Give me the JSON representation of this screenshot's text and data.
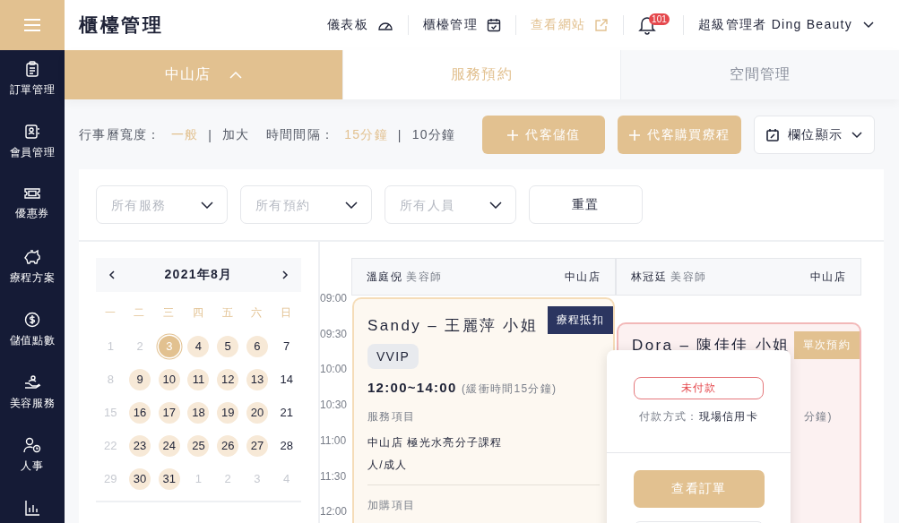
{
  "header": {
    "title": "櫃檯管理",
    "nav": [
      {
        "label": "儀表板",
        "kind": "dashboard"
      },
      {
        "label": "櫃檯管理",
        "kind": "calendar"
      },
      {
        "label": "查看網站",
        "kind": "external"
      }
    ],
    "notifications": "101",
    "user": "超級管理者 Ding Beauty"
  },
  "sidebar": {
    "items": [
      {
        "label": "訂單管理"
      },
      {
        "label": "會員管理"
      },
      {
        "label": "優惠券"
      },
      {
        "label": "療程方案"
      },
      {
        "label": "儲值點數"
      },
      {
        "label": "美容服務"
      },
      {
        "label": "人事"
      }
    ]
  },
  "store_selector": {
    "label": "中山店",
    "expanded": true
  },
  "tabs": [
    {
      "label": "服務預約",
      "selected": true
    },
    {
      "label": "空間管理",
      "selected": false
    }
  ],
  "options": [
    {
      "label": "行事曆寬度：",
      "separator": "|",
      "choices": [
        {
          "label": "一般",
          "selected": true
        },
        {
          "label": "加大",
          "selected": false
        }
      ]
    },
    {
      "label": "時間間隔：",
      "separator": "|",
      "choices": [
        {
          "label": "15分鐘",
          "selected": true
        },
        {
          "label": "10分鐘",
          "selected": false
        }
      ]
    }
  ],
  "actions": [
    {
      "label": "代客儲值",
      "kind": "add"
    },
    {
      "label": "代客購買療程",
      "kind": "add"
    },
    {
      "label": "欄位顯示",
      "kind": "columns"
    }
  ],
  "filters": [
    {
      "placeholder": "所有服務"
    },
    {
      "placeholder": "所有預約"
    },
    {
      "placeholder": "所有人員"
    }
  ],
  "reset_button": "重置",
  "calendar": {
    "month": "2021年8月",
    "weekdays": [
      "一",
      "二",
      "三",
      "四",
      "五",
      "六",
      "日"
    ],
    "weeks": [
      [
        {
          "day": "1",
          "kind": "muted",
          "selected": false
        },
        {
          "day": "2",
          "kind": "muted",
          "selected": false
        },
        {
          "day": "3",
          "kind": "booked",
          "selected": true
        },
        {
          "day": "4",
          "kind": "booked",
          "selected": false
        },
        {
          "day": "5",
          "kind": "booked",
          "selected": false
        },
        {
          "day": "6",
          "kind": "booked",
          "selected": false
        },
        {
          "day": "7",
          "kind": "plain",
          "selected": false
        }
      ],
      [
        {
          "day": "8",
          "kind": "muted",
          "selected": false
        },
        {
          "day": "9",
          "kind": "booked",
          "selected": false
        },
        {
          "day": "10",
          "kind": "booked",
          "selected": false
        },
        {
          "day": "11",
          "kind": "booked",
          "selected": false
        },
        {
          "day": "12",
          "kind": "booked",
          "selected": false
        },
        {
          "day": "13",
          "kind": "booked",
          "selected": false
        },
        {
          "day": "14",
          "kind": "plain",
          "selected": false
        }
      ],
      [
        {
          "day": "15",
          "kind": "muted",
          "selected": false
        },
        {
          "day": "16",
          "kind": "booked",
          "selected": false
        },
        {
          "day": "17",
          "kind": "booked",
          "selected": false
        },
        {
          "day": "18",
          "kind": "booked",
          "selected": false
        },
        {
          "day": "19",
          "kind": "booked",
          "selected": false
        },
        {
          "day": "20",
          "kind": "booked",
          "selected": false
        },
        {
          "day": "21",
          "kind": "plain",
          "selected": false
        }
      ],
      [
        {
          "day": "22",
          "kind": "muted",
          "selected": false
        },
        {
          "day": "23",
          "kind": "booked",
          "selected": false
        },
        {
          "day": "24",
          "kind": "booked",
          "selected": false
        },
        {
          "day": "25",
          "kind": "booked",
          "selected": false
        },
        {
          "day": "26",
          "kind": "booked",
          "selected": false
        },
        {
          "day": "27",
          "kind": "booked",
          "selected": false
        },
        {
          "day": "28",
          "kind": "plain",
          "selected": false
        }
      ],
      [
        {
          "day": "29",
          "kind": "muted",
          "selected": false
        },
        {
          "day": "30",
          "kind": "booked",
          "selected": false
        },
        {
          "day": "31",
          "kind": "booked",
          "selected": false
        },
        {
          "day": "1",
          "kind": "muted",
          "selected": false
        },
        {
          "day": "2",
          "kind": "muted",
          "selected": false
        },
        {
          "day": "3",
          "kind": "muted",
          "selected": false
        },
        {
          "day": "4",
          "kind": "muted",
          "selected": false
        }
      ]
    ]
  },
  "schedule": {
    "times": [
      "09:00",
      "09:30",
      "10:00",
      "10:30",
      "11:00",
      "11:30",
      "12:00"
    ],
    "columns": [
      {
        "staff": "溫庭倪",
        "role": "美容師",
        "store": "中山店",
        "appointments": [
          {
            "kind": "course",
            "customer": "Sandy – 王麗萍 小姐",
            "tag": "療程抵扣",
            "badge": "VVIP",
            "time": "12:00~14:00",
            "buffer": "(緩衝時間15分鐘)",
            "service_heading": "服務項目",
            "service": "中山店 極光水亮分子課程",
            "service_detail": "人/成人",
            "addon_heading": "加購項目"
          }
        ]
      },
      {
        "staff": "林冠廷",
        "role": "美容師",
        "store": "中山店",
        "appointments": [
          {
            "kind": "single",
            "customer": "Dora – 陳佳佳 小姐",
            "tag": "單次預約",
            "buffer": "分鐘)"
          }
        ]
      }
    ]
  },
  "popup": {
    "status": "未付款",
    "payment_label": "付款方式：",
    "payment_value": "現場信用卡",
    "button": "查看訂單"
  }
}
